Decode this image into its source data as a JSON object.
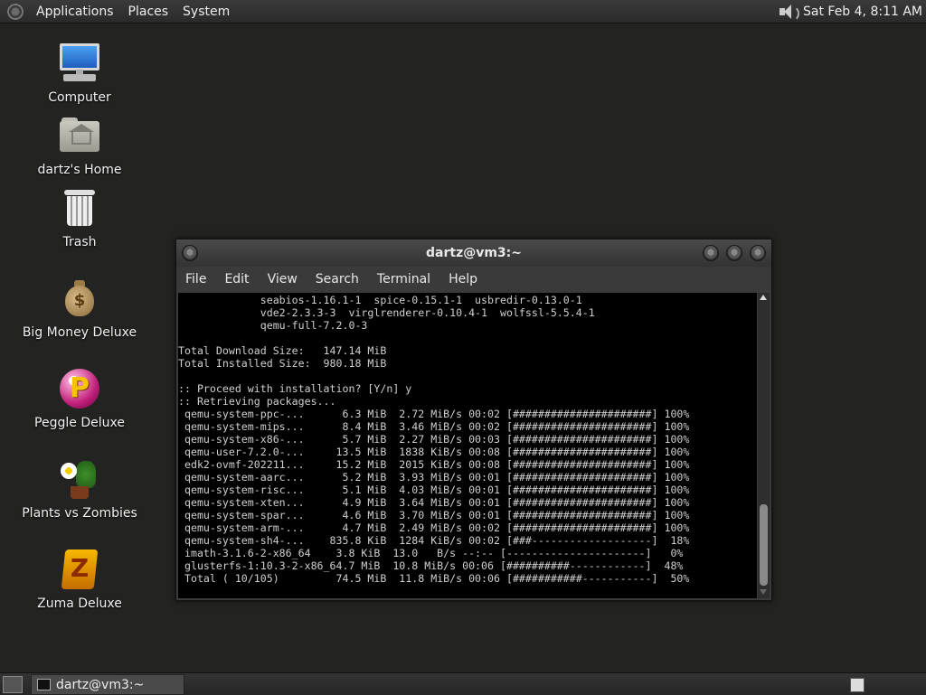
{
  "top_panel": {
    "menus": [
      "Applications",
      "Places",
      "System"
    ],
    "clock": "Sat Feb  4,  8:11 AM",
    "icons": [
      "distro-logo-icon",
      "volume-icon"
    ]
  },
  "desktop_icons": [
    {
      "label": "Computer",
      "icon": "computer-icon"
    },
    {
      "label": "dartz's Home",
      "icon": "home-folder-icon"
    },
    {
      "label": "Trash",
      "icon": "trash-icon"
    },
    {
      "label": "Big Money Deluxe",
      "icon": "money-bag-icon"
    },
    {
      "label": "Peggle Deluxe",
      "icon": "peggle-icon"
    },
    {
      "label": "Plants vs Zombies",
      "icon": "plants-vs-zombies-icon"
    },
    {
      "label": "Zuma Deluxe",
      "icon": "zuma-icon"
    }
  ],
  "terminal": {
    "title": "dartz@vm3:~",
    "menu": [
      "File",
      "Edit",
      "View",
      "Search",
      "Terminal",
      "Help"
    ],
    "lines": [
      "             seabios-1.16.1-1  spice-0.15.1-1  usbredir-0.13.0-1",
      "             vde2-2.3.3-3  virglrenderer-0.10.4-1  wolfssl-5.5.4-1",
      "             qemu-full-7.2.0-3",
      "",
      "Total Download Size:   147.14 MiB",
      "Total Installed Size:  980.18 MiB",
      "",
      ":: Proceed with installation? [Y/n] y",
      ":: Retrieving packages...",
      " qemu-system-ppc-...      6.3 MiB  2.72 MiB/s 00:02 [######################] 100%",
      " qemu-system-mips...      8.4 MiB  3.46 MiB/s 00:02 [######################] 100%",
      " qemu-system-x86-...      5.7 MiB  2.27 MiB/s 00:03 [######################] 100%",
      " qemu-user-7.2.0-...     13.5 MiB  1838 KiB/s 00:08 [######################] 100%",
      " edk2-ovmf-202211...     15.2 MiB  2015 KiB/s 00:08 [######################] 100%",
      " qemu-system-aarc...      5.2 MiB  3.93 MiB/s 00:01 [######################] 100%",
      " qemu-system-risc...      5.1 MiB  4.03 MiB/s 00:01 [######################] 100%",
      " qemu-system-xten...      4.9 MiB  3.64 MiB/s 00:01 [######################] 100%",
      " qemu-system-spar...      4.6 MiB  3.70 MiB/s 00:01 [######################] 100%",
      " qemu-system-arm-...      4.7 MiB  2.49 MiB/s 00:02 [######################] 100%",
      " qemu-system-sh4-...    835.8 KiB  1284 KiB/s 00:02 [###-------------------]  18%",
      " imath-3.1.6-2-x86_64    3.8 KiB  13.0   B/s --:-- [----------------------]   0%",
      " glusterfs-1:10.3-2-x86_64.7 MiB  10.8 MiB/s 00:06 [##########------------]  48%",
      " Total ( 10/105)         74.5 MiB  11.8 MiB/s 00:06 [###########-----------]  50%"
    ]
  },
  "taskbar": {
    "task_label": "dartz@vm3:~"
  }
}
